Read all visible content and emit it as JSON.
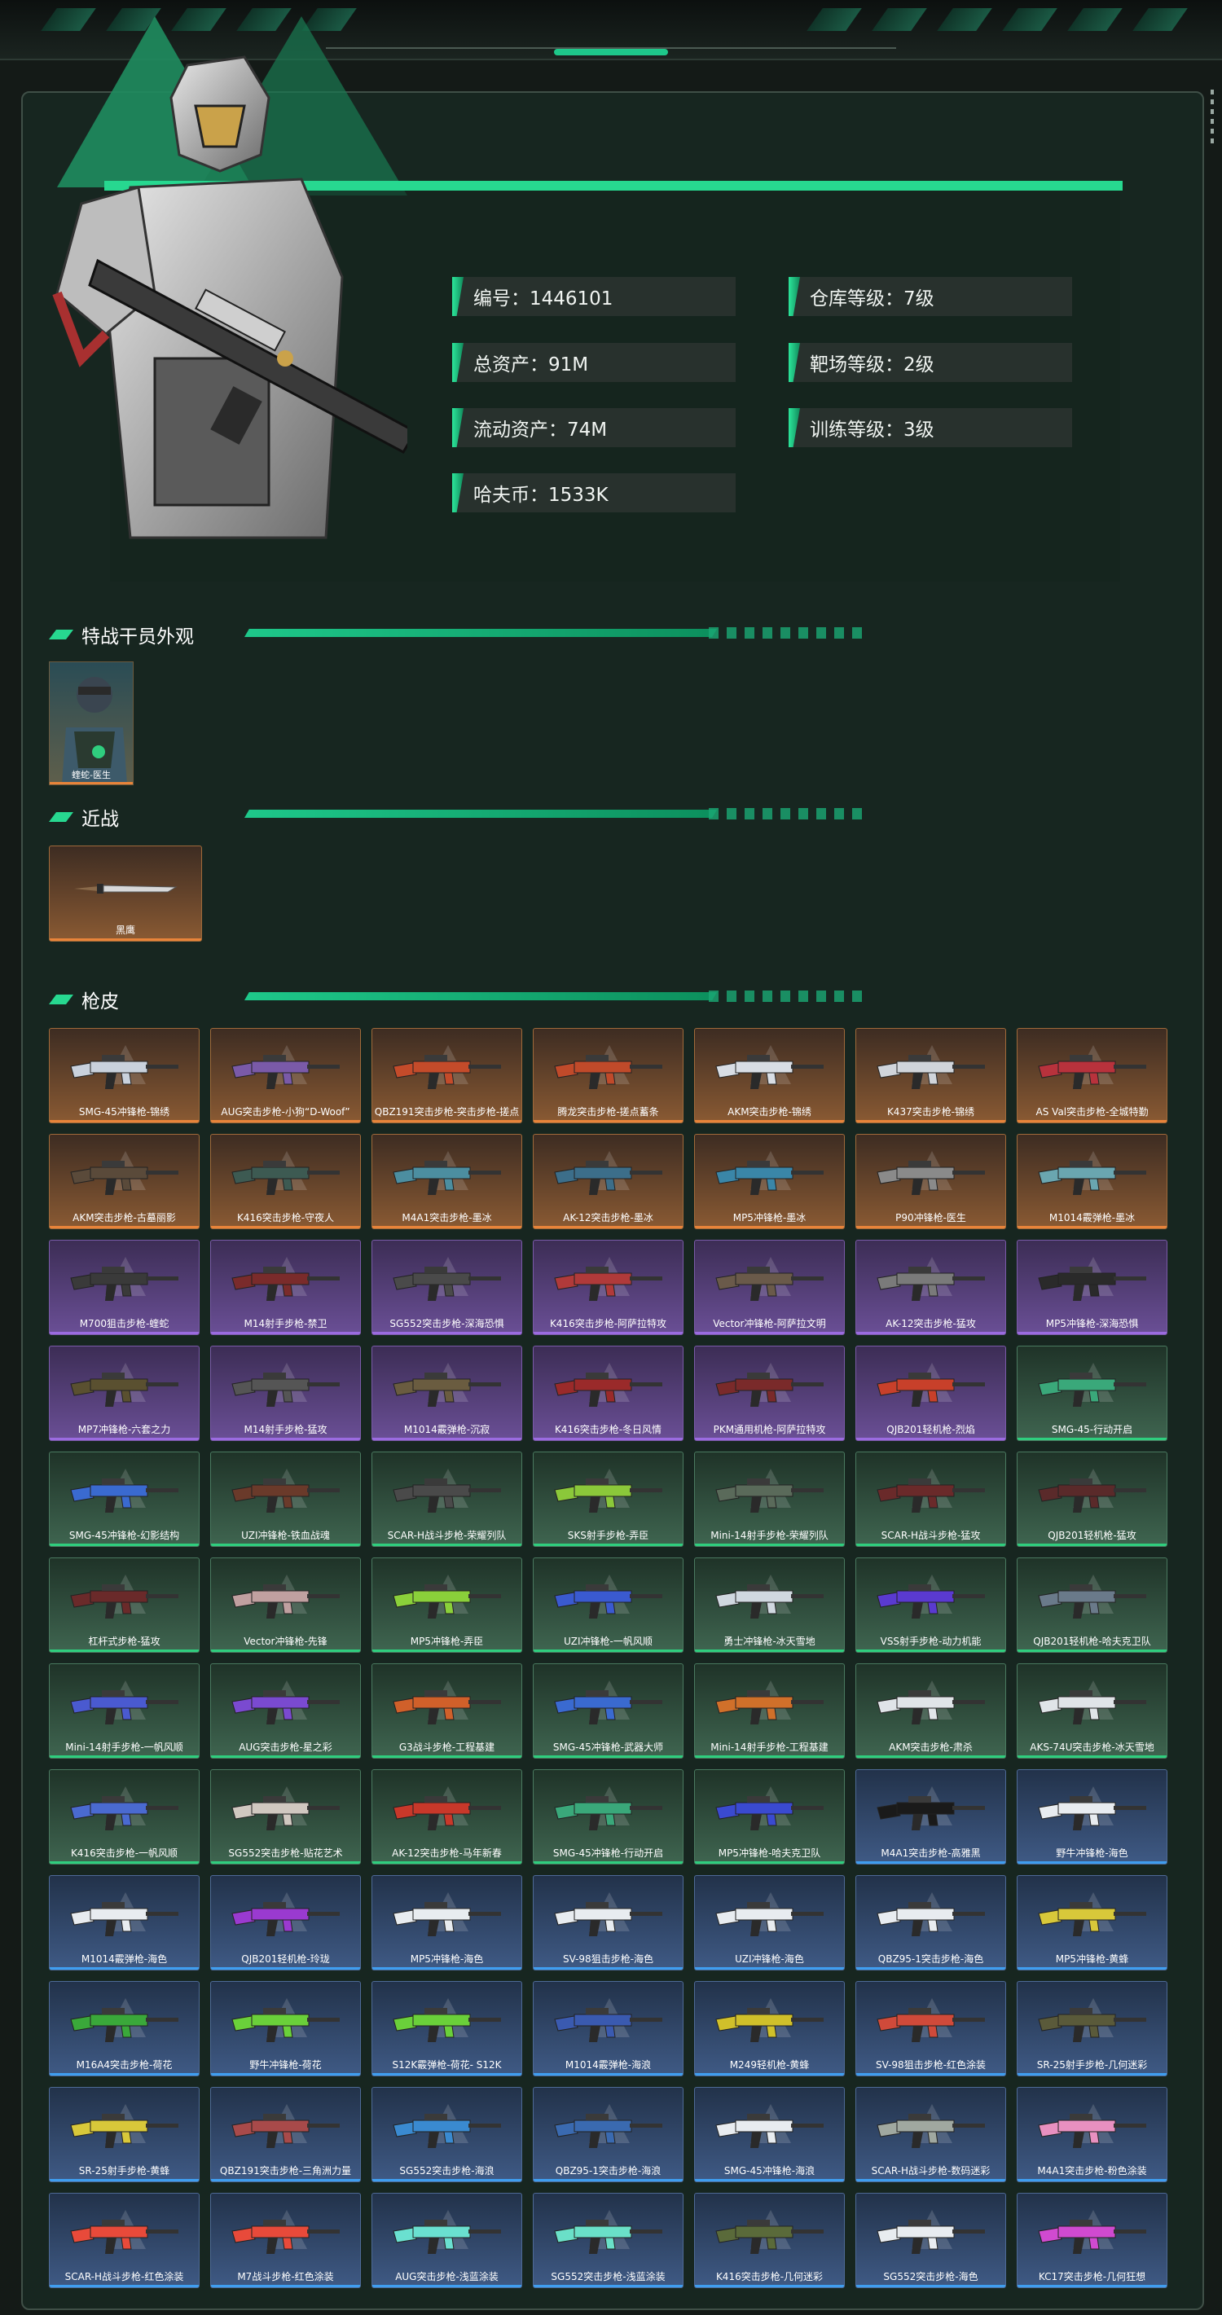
{
  "stats": [
    {
      "label": "编号：1446101"
    },
    {
      "label": "仓库等级：7级"
    },
    {
      "label": "总资产：91M"
    },
    {
      "label": "靶场等级：2级"
    },
    {
      "label": "流动资产：74M"
    },
    {
      "label": "训练等级：3级"
    },
    {
      "label": "哈夫币：1533K"
    }
  ],
  "sections": {
    "agent_title": "特战干员外观",
    "melee_title": "近战",
    "skins_title": "枪皮"
  },
  "agent": {
    "name": "蝰蛇-医生",
    "quality": "orange"
  },
  "melee": {
    "name": "黑鹰",
    "quality": "orange"
  },
  "skins": [
    {
      "name": "SMG-45冲锋枪-锦绣",
      "q": "orange"
    },
    {
      "name": "AUG突击步枪-小狗“D-Woof”",
      "q": "orange"
    },
    {
      "name": "QBZ191突击步枪-突击步枪-搓点",
      "q": "orange"
    },
    {
      "name": "腾龙突击步枪-搓点蓄条",
      "q": "orange"
    },
    {
      "name": "AKM突击步枪-锦绣",
      "q": "orange"
    },
    {
      "name": "K437突击步枪-锦绣",
      "q": "orange"
    },
    {
      "name": "AS Val突击步枪-全城特勤",
      "q": "orange"
    },
    {
      "name": "AKM突击步枪-古墓丽影",
      "q": "orange"
    },
    {
      "name": "K416突击步枪-守夜人",
      "q": "orange"
    },
    {
      "name": "M4A1突击步枪-墨冰",
      "q": "orange"
    },
    {
      "name": "AK-12突击步枪-墨冰",
      "q": "orange"
    },
    {
      "name": "MP5冲锋枪-墨冰",
      "q": "orange"
    },
    {
      "name": "P90冲锋枪-医生",
      "q": "orange"
    },
    {
      "name": "M1014霰弹枪-墨冰",
      "q": "orange"
    },
    {
      "name": "M700狙击步枪-蝰蛇",
      "q": "purple"
    },
    {
      "name": "M14射手步枪-禁卫",
      "q": "purple"
    },
    {
      "name": "SG552突击步枪-深海恐惧",
      "q": "purple"
    },
    {
      "name": "K416突击步枪-阿萨拉特攻",
      "q": "purple"
    },
    {
      "name": "Vector冲锋枪-阿萨拉文明",
      "q": "purple"
    },
    {
      "name": "AK-12突击步枪-猛攻",
      "q": "purple"
    },
    {
      "name": "MP5冲锋枪-深海恐惧",
      "q": "purple"
    },
    {
      "name": "MP7冲锋枪-六套之力",
      "q": "purple"
    },
    {
      "name": "M14射手步枪-猛攻",
      "q": "purple"
    },
    {
      "name": "M1014霰弹枪-沉寂",
      "q": "purple"
    },
    {
      "name": "K416突击步枪-冬日风情",
      "q": "purple"
    },
    {
      "name": "PKM通用机枪-阿萨拉特攻",
      "q": "purple"
    },
    {
      "name": "QJB201轻机枪-烈焰",
      "q": "purple"
    },
    {
      "name": "SMG-45-行动开启",
      "q": "green"
    },
    {
      "name": "SMG-45冲锋枪-幻影结构",
      "q": "green"
    },
    {
      "name": "UZI冲锋枪-铁血战魂",
      "q": "green"
    },
    {
      "name": "SCAR-H战斗步枪-荣耀列队",
      "q": "green"
    },
    {
      "name": "SKS射手步枪-弄臣",
      "q": "green"
    },
    {
      "name": "Mini-14射手步枪-荣耀列队",
      "q": "green"
    },
    {
      "name": "SCAR-H战斗步枪-猛攻",
      "q": "green"
    },
    {
      "name": "QJB201轻机枪-猛攻",
      "q": "green"
    },
    {
      "name": "杠杆式步枪-猛攻",
      "q": "green"
    },
    {
      "name": "Vector冲锋枪-先锋",
      "q": "green"
    },
    {
      "name": "MP5冲锋枪-弄臣",
      "q": "green"
    },
    {
      "name": "UZI冲锋枪-一帆风顺",
      "q": "green"
    },
    {
      "name": "勇士冲锋枪-冰天雪地",
      "q": "green"
    },
    {
      "name": "VSS射手步枪-动力机能",
      "q": "green"
    },
    {
      "name": "QJB201轻机枪-哈夫克卫队",
      "q": "green"
    },
    {
      "name": "Mini-14射手步枪-一帆风顺",
      "q": "green"
    },
    {
      "name": "AUG突击步枪-星之彩",
      "q": "green"
    },
    {
      "name": "G3战斗步枪-工程基建",
      "q": "green"
    },
    {
      "name": "SMG-45冲锋枪-武器大师",
      "q": "green"
    },
    {
      "name": "Mini-14射手步枪-工程基建",
      "q": "green"
    },
    {
      "name": "AKM突击步枪-肃杀",
      "q": "green"
    },
    {
      "name": "AKS-74U突击步枪-冰天雪地",
      "q": "green"
    },
    {
      "name": "K416突击步枪-一帆风顺",
      "q": "green"
    },
    {
      "name": "SG552突击步枪-贴花艺术",
      "q": "green"
    },
    {
      "name": "AK-12突击步枪-马年新春",
      "q": "green"
    },
    {
      "name": "SMG-45冲锋枪-行动开启",
      "q": "green"
    },
    {
      "name": "MP5冲锋枪-哈夫克卫队",
      "q": "green"
    },
    {
      "name": "M4A1突击步枪-高雅黑",
      "q": "blue"
    },
    {
      "name": "野牛冲锋枪-海色",
      "q": "blue"
    },
    {
      "name": "M1014霰弹枪-海色",
      "q": "blue"
    },
    {
      "name": "QJB201轻机枪-玲珑",
      "q": "blue"
    },
    {
      "name": "MP5冲锋枪-海色",
      "q": "blue"
    },
    {
      "name": "SV-98狙击步枪-海色",
      "q": "blue"
    },
    {
      "name": "UZI冲锋枪-海色",
      "q": "blue"
    },
    {
      "name": "QBZ95-1突击步枪-海色",
      "q": "blue"
    },
    {
      "name": "MP5冲锋枪-黄蜂",
      "q": "blue"
    },
    {
      "name": "M16A4突击步枪-荷花",
      "q": "blue"
    },
    {
      "name": "野牛冲锋枪-荷花",
      "q": "blue"
    },
    {
      "name": "S12K霰弹枪-荷花- S12K",
      "q": "blue"
    },
    {
      "name": "M1014霰弹枪-海浪",
      "q": "blue"
    },
    {
      "name": "M249轻机枪-黄蜂",
      "q": "blue"
    },
    {
      "name": "SV-98狙击步枪-红色涂装",
      "q": "blue"
    },
    {
      "name": "SR-25射手步枪-几何迷彩",
      "q": "blue"
    },
    {
      "name": "SR-25射手步枪-黄蜂",
      "q": "blue"
    },
    {
      "name": "QBZ191突击步枪-三角洲力量",
      "q": "blue"
    },
    {
      "name": "SG552突击步枪-海浪",
      "q": "blue"
    },
    {
      "name": "QBZ95-1突击步枪-海浪",
      "q": "blue"
    },
    {
      "name": "SMG-45冲锋枪-海浪",
      "q": "blue"
    },
    {
      "name": "SCAR-H战斗步枪-数码迷彩",
      "q": "blue"
    },
    {
      "name": "M4A1突击步枪-粉色涂装",
      "q": "blue"
    },
    {
      "name": "SCAR-H战斗步枪-红色涂装",
      "q": "blue"
    },
    {
      "name": "M7战斗步枪-红色涂装",
      "q": "blue"
    },
    {
      "name": "AUG突击步枪-浅蓝涂装",
      "q": "blue"
    },
    {
      "name": "SG552突击步枪-浅蓝涂装",
      "q": "blue"
    },
    {
      "name": "K416突击步枪-几何迷彩",
      "q": "blue"
    },
    {
      "name": "SG552突击步枪-海色",
      "q": "blue"
    },
    {
      "name": "KC17突击步枪-几何狂想",
      "q": "blue"
    }
  ],
  "skin_colors": [
    "#c9d1dc",
    "#7a5aa8",
    "#c44b2a",
    "#c04a2a",
    "#d8dde4",
    "#d0d4da",
    "#b8323c",
    "#5a4a3a",
    "#3d5a52",
    "#4c8ea0",
    "#3c6e8a",
    "#3a86a8",
    "#8a8a8a",
    "#6aa6b0",
    "#3a3a3a",
    "#7a2b2b",
    "#4a4a4a",
    "#b03a3a",
    "#6a5a4a",
    "#7a7a7a",
    "#2a2a2a",
    "#5a5030",
    "#555555",
    "#6a5c40",
    "#9a2a2a",
    "#7a2a2a",
    "#c8402a",
    "#3aa87a",
    "#3a6ad0",
    "#6a3a2a",
    "#4a4a4a",
    "#8bc83a",
    "#5a6a5a",
    "#6a2a2a",
    "#5a2a2a",
    "#6a2a2a",
    "#c0a0a0",
    "#8ad03a",
    "#3a5ad0",
    "#d0d8e0",
    "#5a3ad0",
    "#6a7a8a",
    "#4a5ad0",
    "#7a4ad0",
    "#d0602a",
    "#3a6ad0",
    "#d0702a",
    "#e0e4e8",
    "#e0e4e8",
    "#4a6ad0",
    "#d0c8c0",
    "#c8382a",
    "#3aa87a",
    "#3a4ad0",
    "#1a1a1a",
    "#e8ecf0",
    "#e8ecf0",
    "#9a3ad0",
    "#e8ecf0",
    "#e8ecf0",
    "#e8ecf0",
    "#e8ecf0",
    "#d8c83a",
    "#3aa83a",
    "#6ad03a",
    "#6ad03a",
    "#3a5ab0",
    "#d0c02a",
    "#d04a3a",
    "#5a5a3a",
    "#d8c83a",
    "#a84a4a",
    "#3a8ad0",
    "#3a6ab0",
    "#e8ecf0",
    "#a0a8a0",
    "#e890c0",
    "#e84a3a",
    "#e84a3a",
    "#6ae0d0",
    "#6ae0c8",
    "#5a6a3a",
    "#e8ecf0",
    "#d04ad0"
  ]
}
